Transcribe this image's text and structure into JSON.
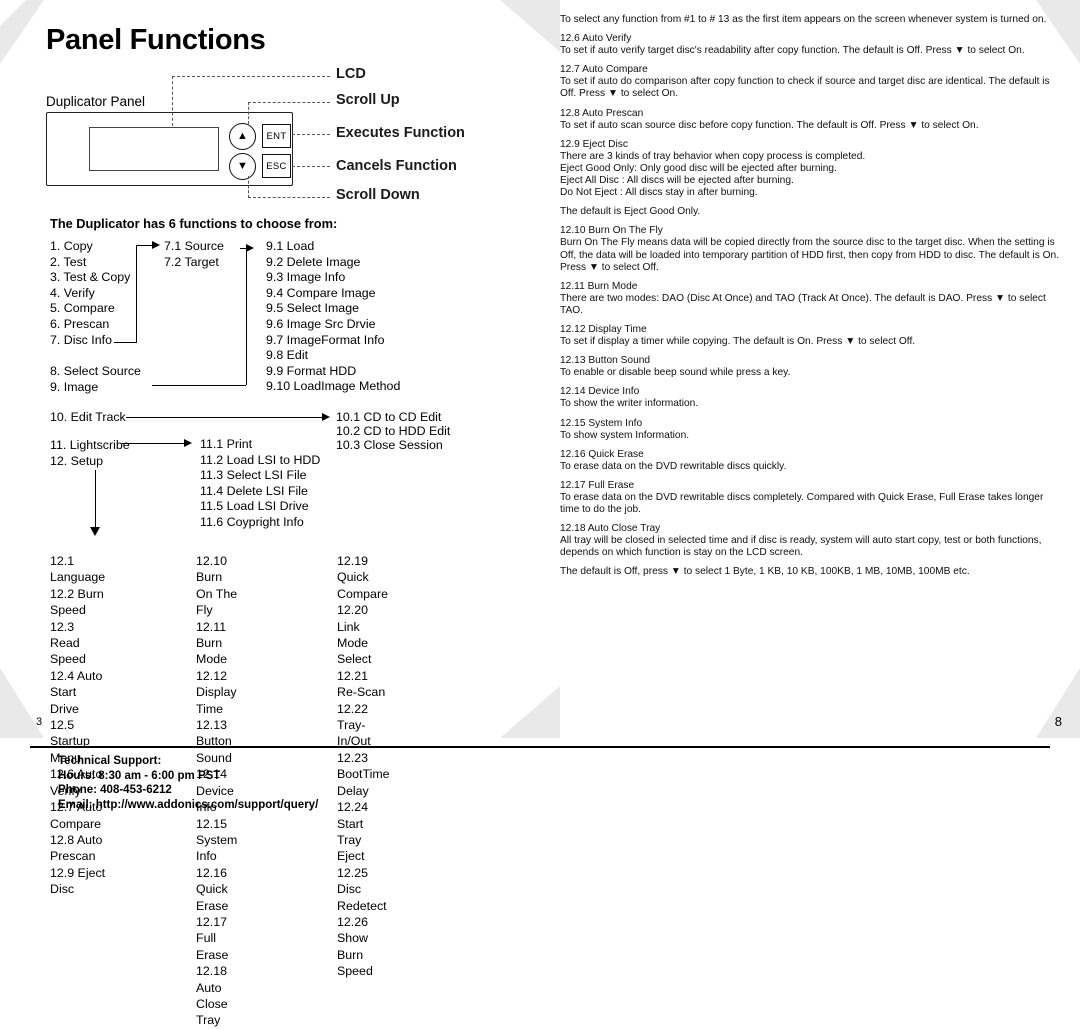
{
  "page": {
    "title": "Panel Functions",
    "page_number_left": "3",
    "page_number_right": "8"
  },
  "panel_diagram": {
    "label": "Duplicator Panel",
    "buttons": {
      "up_arrow": "▲",
      "down_arrow": "▼",
      "ent": "ENT",
      "esc": "ESC"
    },
    "callouts": [
      "LCD",
      "Scroll Up",
      "Executes Function",
      "Cancels Function",
      "Scroll Down"
    ]
  },
  "functions_heading": "The Duplicator has 6 functions to choose from:",
  "menu": {
    "col1": [
      "1. Copy",
      "2. Test",
      "3. Test & Copy",
      "4. Verify",
      "5. Compare",
      "6. Prescan",
      "7. Disc Info"
    ],
    "col1b": [
      "8. Select Source",
      "9. Image"
    ],
    "col2": [
      "7.1 Source",
      "7.2 Target"
    ],
    "col3": [
      "9.1 Load",
      "9.2 Delete Image",
      "9.3 Image Info",
      "9.4 Compare Image",
      "9.5 Select Image",
      "9.6 Image Src Drvie",
      "9.7 ImageFormat Info",
      "9.8 Edit",
      "9.9 Format HDD",
      "9.10 LoadImage Method"
    ],
    "edit_track": "10. Edit Track",
    "col10": [
      "10.1 CD to CD Edit",
      "10.2 CD to HDD Edit",
      "10.3 Close Session"
    ],
    "lightscribe": [
      "11. Lightscribe",
      "12. Setup"
    ],
    "col11": [
      "11.1 Print",
      "11.2 Load LSI to HDD",
      "11.3 Select LSI File",
      "11.4 Delete LSI File",
      "11.5 Load LSI Drive",
      "11.6 Coypright Info"
    ],
    "setup_col1": [
      "12.1 Language",
      "12.2 Burn Speed",
      "12.3 Read Speed",
      "12.4 Auto Start Drive",
      "12.5 Startup Menu",
      "12.6 Auto Verify",
      "12.7 Auto Compare",
      "12.8 Auto Prescan",
      "12.9 Eject Disc"
    ],
    "setup_col2": [
      "12.10 Burn On The Fly",
      "12.11 Burn Mode",
      "12.12 Display Time",
      "12.13 Button Sound",
      "12.14 Device Info",
      "12.15 System Info",
      "12.16 Quick Erase",
      "12.17 Full Erase",
      "12.18 Auto Close Tray"
    ],
    "setup_col3": [
      "12.19 Quick Compare",
      "12.20 Link Mode Select",
      "12.21 Re-Scan",
      "12.22 Tray-In/Out",
      "12.23 BootTime Delay",
      "12.24 Start Tray Eject",
      "12.25 Disc Redetect",
      "12.26 Show Burn Speed"
    ]
  },
  "right_column": {
    "intro": "To select any function from #1 to # 13 as the first item appears on the screen whenever system is turned on.",
    "sections": [
      {
        "heading": "12.6 Auto Verify",
        "body": "To set if auto verify target disc's readability after copy function. The default is Off. Press ▼ to select On."
      },
      {
        "heading": "12.7 Auto Compare",
        "body": "To set if auto do comparison after copy function to check if source and target disc are identical. The default is Off. Press ▼ to select On."
      },
      {
        "heading": "12.8 Auto Prescan",
        "body": "To set if auto scan source disc before copy function. The default is Off. Press ▼ to select On."
      },
      {
        "heading": "12.9 Eject Disc",
        "body": "There are 3 kinds of tray behavior when copy process is completed.\nEject Good Only: Only good disc will be ejected after burning.\nEject All Disc : All discs will be ejected after burning.\nDo Not Eject : All discs stay in after burning.",
        "body2": "The default is Eject Good Only."
      },
      {
        "heading": "12.10 Burn On The Fly",
        "body": "Burn On The Fly means data will be copied directly from the source disc to the target disc. When the setting is Off, the data will be loaded into temporary partition of HDD first, then copy from HDD to disc. The default is On. Press ▼ to select Off."
      },
      {
        "heading": "12.11 Burn Mode",
        "body": "There are two modes: DAO (Disc At Once) and TAO (Track At Once). The default is DAO. Press ▼ to select TAO."
      },
      {
        "heading": "12.12 Display Time",
        "body": "To set if display a timer while copying. The default is On. Press ▼ to select Off."
      },
      {
        "heading": "12.13 Button Sound",
        "body": "To enable or disable beep sound while press a key."
      },
      {
        "heading": "12.14 Device Info",
        "body": "To show the writer information."
      },
      {
        "heading": "12.15 System Info",
        "body": "To show system Information."
      },
      {
        "heading": "12.16 Quick Erase",
        "body": "To erase data on the DVD rewritable discs quickly."
      },
      {
        "heading": "12.17 Full Erase",
        "body": "To erase data on the DVD rewritable discs completely. Compared with Quick Erase, Full Erase takes longer time to do the job."
      },
      {
        "heading": "12.18 Auto Close Tray",
        "body": "All tray will be closed in selected time and if disc is ready, system will auto start copy, test or both functions, depends on which function is stay on the LCD screen."
      }
    ],
    "closing": "The default is Off, press ▼ to select 1 Byte, 1 KB, 10 KB, 100KB, 1 MB, 10MB, 100MB etc."
  },
  "footer": {
    "line1": "Technical Support:",
    "line2": "Hours:  8:30 am - 6:00 pm PST",
    "line3": "Phone: 408-453-6212",
    "line4": "Email:  http://www.addonics.com/support/query/"
  }
}
